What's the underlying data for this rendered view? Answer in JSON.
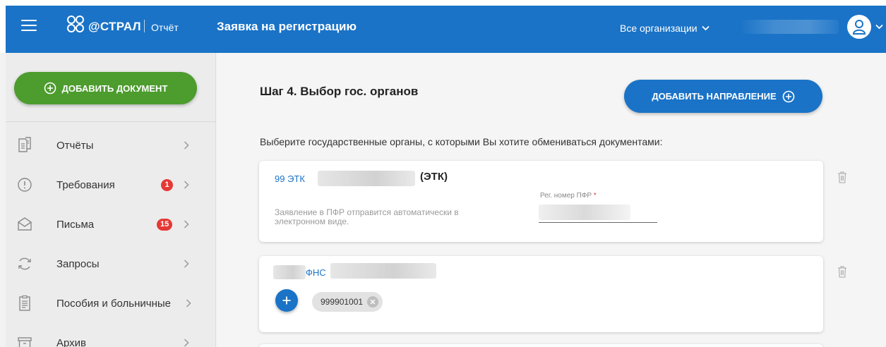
{
  "header": {
    "logo_text": "@СТРАЛ",
    "logo_subtitle": "Отчёт",
    "page_title": "Заявка на регистрацию",
    "org_select": "Все организации"
  },
  "sidebar": {
    "add_document_label": "ДОБАВИТЬ ДОКУМЕНТ",
    "items": [
      {
        "label": "Отчёты",
        "icon": "reports-icon"
      },
      {
        "label": "Требования",
        "icon": "requirements-icon",
        "badge": "1"
      },
      {
        "label": "Письма",
        "icon": "letters-icon",
        "badge": "15"
      },
      {
        "label": "Запросы",
        "icon": "requests-icon"
      },
      {
        "label": "Пособия и больничные",
        "icon": "benefits-icon"
      },
      {
        "label": "Архив",
        "icon": "archive-icon"
      }
    ]
  },
  "main": {
    "step_title": "Шаг 4. Выбор гос. органов",
    "add_direction_label": "ДОБАВИТЬ НАПРАВЛЕНИЕ",
    "instructions": "Выберите государственные органы, с которыми Вы хотите обмениваться документами:",
    "cards": [
      {
        "code": "99 ЭТК",
        "suffix": "(ЭТК)",
        "note": "Заявление в ПФР отправится автоматически в электронном виде.",
        "field_label": "Рег. номер ПФР",
        "field_required": "*"
      },
      {
        "code": "ФНС",
        "chip": "999901001"
      }
    ]
  },
  "colors": {
    "brand_blue": "#1a73c7",
    "add_green": "#4c9c2e",
    "badge_red": "#e53935"
  }
}
